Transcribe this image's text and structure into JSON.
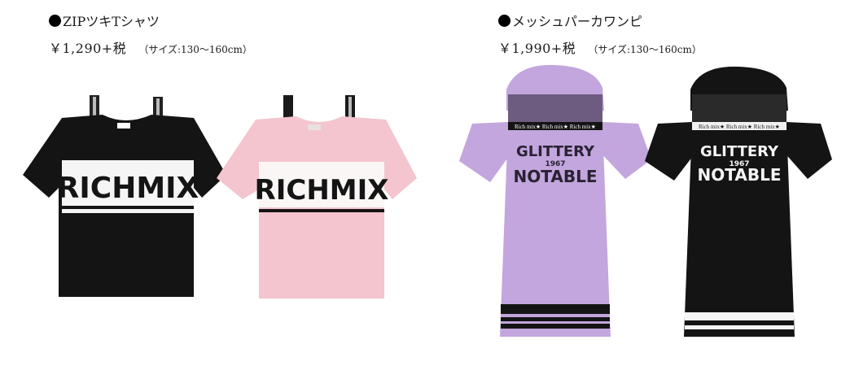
{
  "products": [
    {
      "bullet": "●",
      "name": "ZIPツキTシャツ",
      "price": "￥1,290+税",
      "size": "（サイズ:130〜160cm）",
      "items": [
        {
          "icon": "black-zip-tshirt-image",
          "print": "RICHMIX",
          "color": "#141414"
        },
        {
          "icon": "pink-zip-tshirt-image",
          "print": "RICHMIX",
          "color": "#f4c5cf"
        }
      ]
    },
    {
      "bullet": "●",
      "name": "メッシュパーカワンピ",
      "price": "￥1,990+税",
      "size": "（サイズ:130〜160cm）",
      "items": [
        {
          "icon": "lavender-hooded-dress-image",
          "print_line1": "GLITTERY",
          "print_line2": "1967",
          "print_line3": "NOTABLE",
          "tape": "Rich mix★ Rich mix★ Rich mix★",
          "color": "#c2a6dd"
        },
        {
          "icon": "black-hooded-dress-image",
          "print_line1": "GLITTERY",
          "print_line2": "1967",
          "print_line3": "NOTABLE",
          "tape": "Rich mix★ Rich mix★ Rich mix★",
          "color": "#141414"
        }
      ]
    }
  ]
}
